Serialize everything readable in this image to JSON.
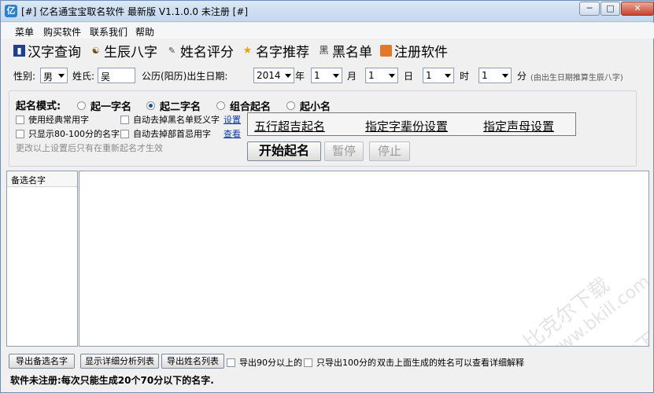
{
  "window": {
    "title": "[#] 亿名通宝宝取名软件 最新版 V1.1.0.0 未注册 [#]",
    "min_label": "─",
    "max_label": "□",
    "close_label": "✕"
  },
  "menu": [
    "菜单",
    "购买软件",
    "联系我们",
    "帮助"
  ],
  "toolbar": [
    {
      "label": "汉字查询",
      "icon": "book-icon"
    },
    {
      "label": "生辰八字",
      "icon": "bagua-icon"
    },
    {
      "label": "姓名评分",
      "icon": "edit-icon"
    },
    {
      "label": "名字推荐",
      "icon": "star-icon"
    },
    {
      "label": "黑名单",
      "icon": "blacklist-icon"
    },
    {
      "label": "注册软件",
      "icon": "register-icon"
    }
  ],
  "info": {
    "gender_label": "性别:",
    "gender_value": "男",
    "surname_label": "姓氏:",
    "surname_value": "吴",
    "birthday_label": "公历(阳历)出生日期:",
    "year_value": "2014",
    "year_unit": "年",
    "month_value": "1",
    "month_unit": "月",
    "day_value": "1",
    "day_unit": "日",
    "hour_value": "1",
    "hour_unit": "时",
    "minute_value": "1",
    "minute_unit": "分",
    "hint": "(由出生日期推算生辰八字)"
  },
  "mode": {
    "label": "起名模式:",
    "options": [
      "起一字名",
      "起二字名",
      "组合起名",
      "起小名"
    ],
    "selected_index": 1
  },
  "options": {
    "classic_chars": "使用经典常用字",
    "remove_blacklist_chars": "自动去掉黑名单贬义字",
    "settings_link": "设置",
    "only_80_100": "只显示80-100分的名字",
    "remove_taboo_chars": "自动去掉部首忌用字",
    "view_link": "查看",
    "note": "更改以上设置后只有在重新起名才生效"
  },
  "settings_links": [
    "五行超吉起名",
    "指定字辈份设置",
    "指定声母设置"
  ],
  "actions": {
    "start": "开始起名",
    "pause": "暂停",
    "stop": "停止"
  },
  "list": {
    "column_header": "备选名字"
  },
  "bottom": {
    "export_candidates": "导出备选名字",
    "show_analysis": "显示详细分析列表",
    "export_names": "导出姓名列表",
    "export_90": "导出90分以上的",
    "export_100": "只导出100分的",
    "double_click_hint": "双击上面生成的姓名可以查看详细解释"
  },
  "status": "软件未注册:每次只能生成20个70分以下的名字.",
  "watermark": [
    "比克尔下载",
    "www.bkill.com",
    "比克尔下载"
  ]
}
